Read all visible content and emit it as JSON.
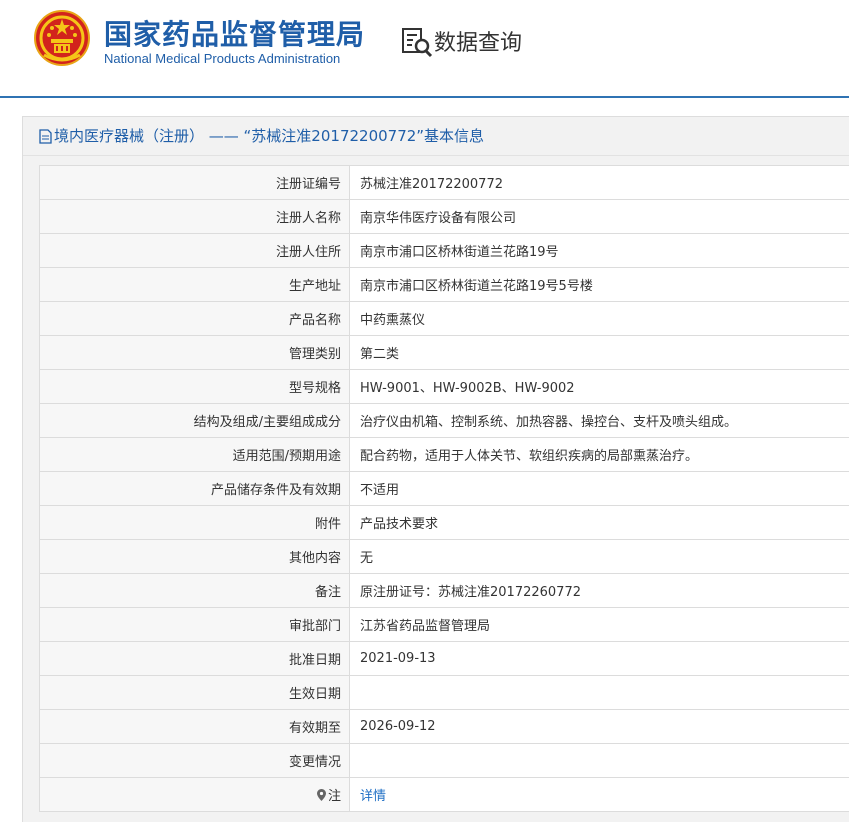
{
  "header": {
    "site_title": "国家药品监督管理局",
    "site_subtitle": "National Medical Products Administration",
    "query_title": "数据查询"
  },
  "panel": {
    "title": "境内医疗器械（注册） —— “苏械注准20172200772”基本信息"
  },
  "rows": [
    {
      "label": "注册证编号",
      "value": "苏械注准20172200772"
    },
    {
      "label": "注册人名称",
      "value": "南京华伟医疗设备有限公司"
    },
    {
      "label": "注册人住所",
      "value": "南京市浦口区桥林街道兰花路19号"
    },
    {
      "label": "生产地址",
      "value": "南京市浦口区桥林街道兰花路19号5号楼"
    },
    {
      "label": "产品名称",
      "value": "中药熏蒸仪"
    },
    {
      "label": "管理类别",
      "value": "第二类"
    },
    {
      "label": "型号规格",
      "value": "HW-9001、HW-9002B、HW-9002"
    },
    {
      "label": "结构及组成/主要组成成分",
      "value": "治疗仪由机箱、控制系统、加热容器、操控台、支杆及喷头组成。"
    },
    {
      "label": "适用范围/预期用途",
      "value": "配合药物，适用于人体关节、软组织疾病的局部熏蒸治疗。"
    },
    {
      "label": "产品储存条件及有效期",
      "value": "不适用"
    },
    {
      "label": "附件",
      "value": "产品技术要求"
    },
    {
      "label": "其他内容",
      "value": "无"
    },
    {
      "label": "备注",
      "value": "原注册证号：苏械注准20172260772"
    },
    {
      "label": "审批部门",
      "value": "江苏省药品监督管理局"
    },
    {
      "label": "批准日期",
      "value": "2021-09-13"
    },
    {
      "label": "生效日期",
      "value": ""
    },
    {
      "label": "有效期至",
      "value": "2026-09-12"
    },
    {
      "label": "变更情况",
      "value": ""
    }
  ],
  "note": {
    "label": "注",
    "link_text": "详情"
  },
  "colors": {
    "brand_blue": "#1f5ea8",
    "link_blue": "#1f6fc5",
    "emblem_red": "#d2231c",
    "emblem_gold": "#f5c518"
  }
}
